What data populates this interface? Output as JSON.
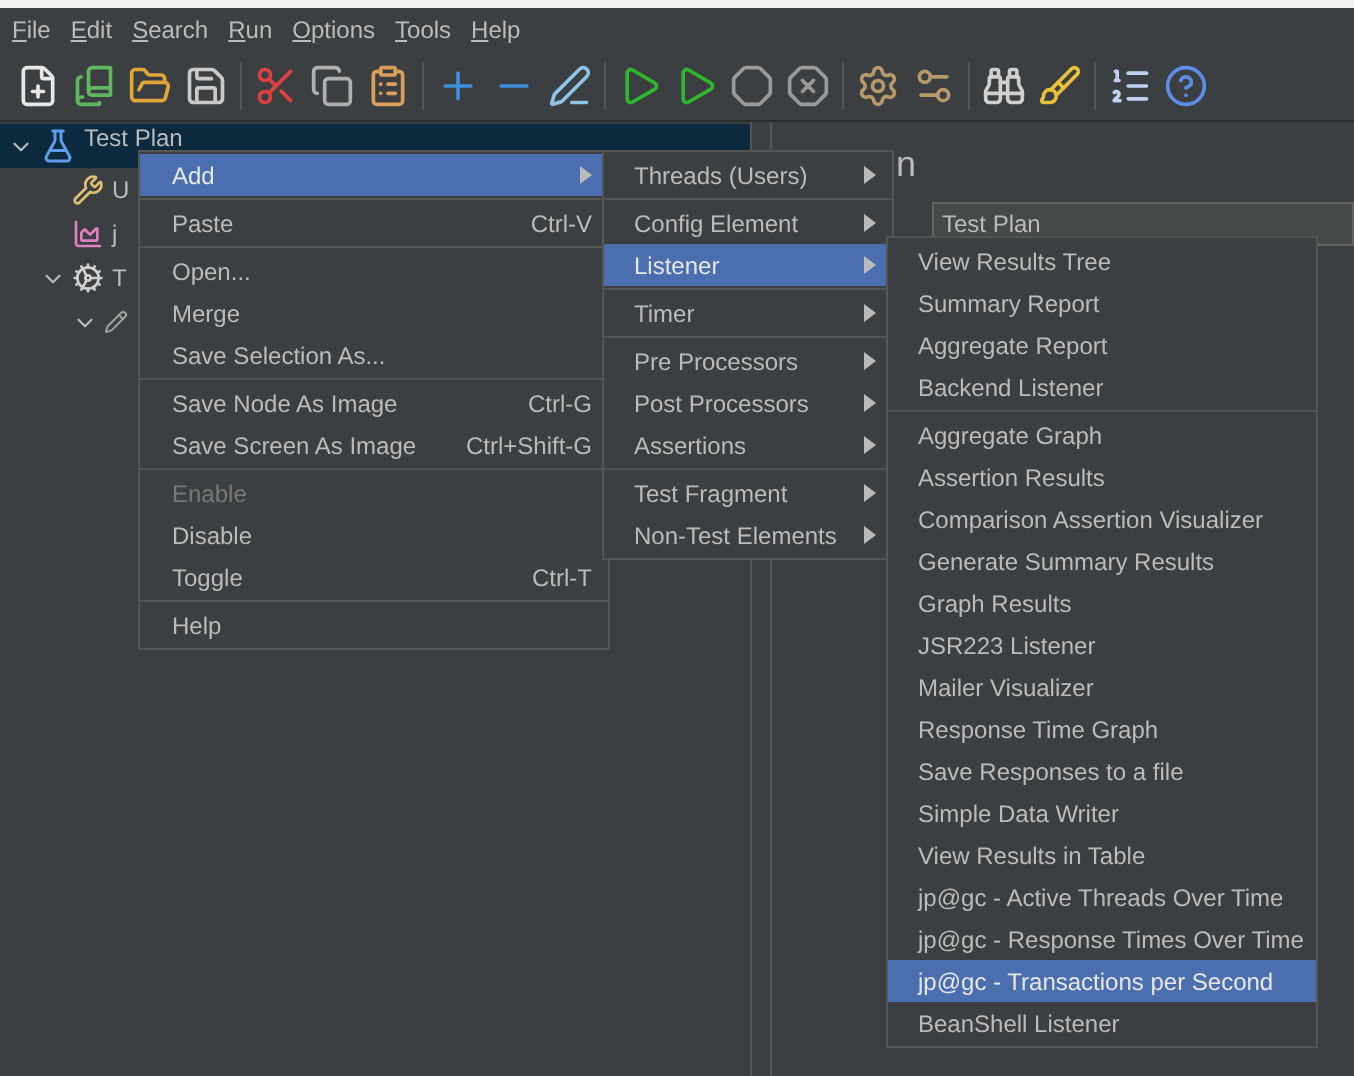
{
  "menubar": [
    "File",
    "Edit",
    "Search",
    "Run",
    "Options",
    "Tools",
    "Help"
  ],
  "tree": {
    "label": "Test Plan",
    "expanded": true,
    "selected": true,
    "children": [
      {
        "label": "U"
      },
      {
        "label": "j"
      },
      {
        "label": "T",
        "expanded": true,
        "children": [
          {
            "expanded": true
          }
        ]
      }
    ]
  },
  "panel": {
    "title": "n",
    "name_field": "Test Plan"
  },
  "context_menu": {
    "sections": [
      [
        {
          "label": "Add",
          "submenu": true,
          "selected": true,
          "disabled": false
        }
      ],
      [
        {
          "label": "Paste",
          "shortcut": "Ctrl-V",
          "submenu": false,
          "selected": false,
          "disabled": false
        }
      ],
      [
        {
          "label": "Open...",
          "submenu": false,
          "selected": false,
          "disabled": false
        },
        {
          "label": "Merge",
          "submenu": false,
          "selected": false,
          "disabled": false
        },
        {
          "label": "Save Selection As...",
          "submenu": false,
          "selected": false,
          "disabled": false
        }
      ],
      [
        {
          "label": "Save Node As Image",
          "shortcut": "Ctrl-G",
          "submenu": false,
          "selected": false,
          "disabled": false
        },
        {
          "label": "Save Screen As Image",
          "shortcut": "Ctrl+Shift-G",
          "submenu": false,
          "selected": false,
          "disabled": false
        }
      ],
      [
        {
          "label": "Enable",
          "submenu": false,
          "selected": false,
          "disabled": true
        },
        {
          "label": "Disable",
          "submenu": false,
          "selected": false,
          "disabled": false
        },
        {
          "label": "Toggle",
          "shortcut": "Ctrl-T",
          "submenu": false,
          "selected": false,
          "disabled": false
        }
      ],
      [
        {
          "label": "Help",
          "submenu": false,
          "selected": false,
          "disabled": false
        }
      ]
    ]
  },
  "add_submenu": {
    "sections": [
      [
        {
          "label": "Threads (Users)",
          "submenu": true,
          "selected": false
        }
      ],
      [
        {
          "label": "Config Element",
          "submenu": true,
          "selected": false
        },
        {
          "label": "Listener",
          "submenu": true,
          "selected": true
        }
      ],
      [
        {
          "label": "Timer",
          "submenu": true,
          "selected": false
        }
      ],
      [
        {
          "label": "Pre Processors",
          "submenu": true,
          "selected": false
        },
        {
          "label": "Post Processors",
          "submenu": true,
          "selected": false
        },
        {
          "label": "Assertions",
          "submenu": true,
          "selected": false
        }
      ],
      [
        {
          "label": "Test Fragment",
          "submenu": true,
          "selected": false
        },
        {
          "label": "Non-Test Elements",
          "submenu": true,
          "selected": false
        }
      ]
    ]
  },
  "listener_submenu": {
    "sections": [
      [
        {
          "label": "View Results Tree",
          "selected": false
        },
        {
          "label": "Summary Report",
          "selected": false
        },
        {
          "label": "Aggregate Report",
          "selected": false
        },
        {
          "label": "Backend Listener",
          "selected": false
        }
      ],
      [
        {
          "label": "Aggregate Graph",
          "selected": false
        },
        {
          "label": "Assertion Results",
          "selected": false
        },
        {
          "label": "Comparison Assertion Visualizer",
          "selected": false
        },
        {
          "label": "Generate Summary Results",
          "selected": false
        },
        {
          "label": "Graph Results",
          "selected": false
        },
        {
          "label": "JSR223 Listener",
          "selected": false
        },
        {
          "label": "Mailer Visualizer",
          "selected": false
        },
        {
          "label": "Response Time Graph",
          "selected": false
        },
        {
          "label": "Save Responses to a file",
          "selected": false
        },
        {
          "label": "Simple Data Writer",
          "selected": false
        },
        {
          "label": "View Results in Table",
          "selected": false
        },
        {
          "label": "jp@gc - Active Threads Over Time",
          "selected": false
        },
        {
          "label": "jp@gc - Response Times Over Time",
          "selected": false
        },
        {
          "label": "jp@gc - Transactions per Second",
          "selected": true
        },
        {
          "label": "BeanShell Listener",
          "selected": false
        }
      ]
    ]
  }
}
